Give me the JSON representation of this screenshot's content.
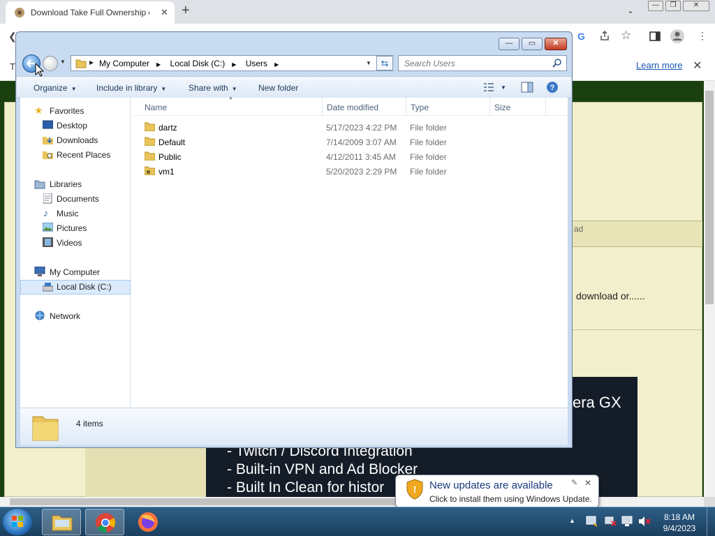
{
  "browser": {
    "tab_title": "Download Take Full Ownership of",
    "infobar_link": "Learn more"
  },
  "webpage": {
    "ad_snippet": "ad",
    "download_snippet": "download or......",
    "banner_lines": [
      "- Twitch / Discord Integration",
      "- Built-in VPN and Ad Blocker",
      "- Built In Clean for histor"
    ],
    "banner_brand": "era GX"
  },
  "explorer": {
    "breadcrumb": [
      "My Computer",
      "Local Disk (C:)",
      "Users"
    ],
    "search_placeholder": "Search Users",
    "commands": [
      "Organize",
      "Include in library",
      "Share with",
      "New folder"
    ],
    "nav": {
      "favorites": "Favorites",
      "desktop": "Desktop",
      "downloads": "Downloads",
      "recent": "Recent Places",
      "libraries": "Libraries",
      "documents": "Documents",
      "music": "Music",
      "pictures": "Pictures",
      "videos": "Videos",
      "computer": "My Computer",
      "localdisk": "Local Disk (C:)",
      "network": "Network"
    },
    "columns": {
      "name": "Name",
      "date": "Date modified",
      "type": "Type",
      "size": "Size"
    },
    "rows": [
      {
        "name": "dartz",
        "date": "5/17/2023 4:22 PM",
        "type": "File folder"
      },
      {
        "name": "Default",
        "date": "7/14/2009 3:07 AM",
        "type": "File folder"
      },
      {
        "name": "Public",
        "date": "4/12/2011 3:45 AM",
        "type": "File folder"
      },
      {
        "name": "vm1",
        "date": "5/20/2023 2:29 PM",
        "type": "File folder"
      }
    ],
    "item_count": "4 items"
  },
  "notification": {
    "title": "New updates are available",
    "subtitle": "Click to install them using Windows Update."
  },
  "taskbar": {
    "time": "8:18 AM",
    "date": "9/4/2023"
  }
}
